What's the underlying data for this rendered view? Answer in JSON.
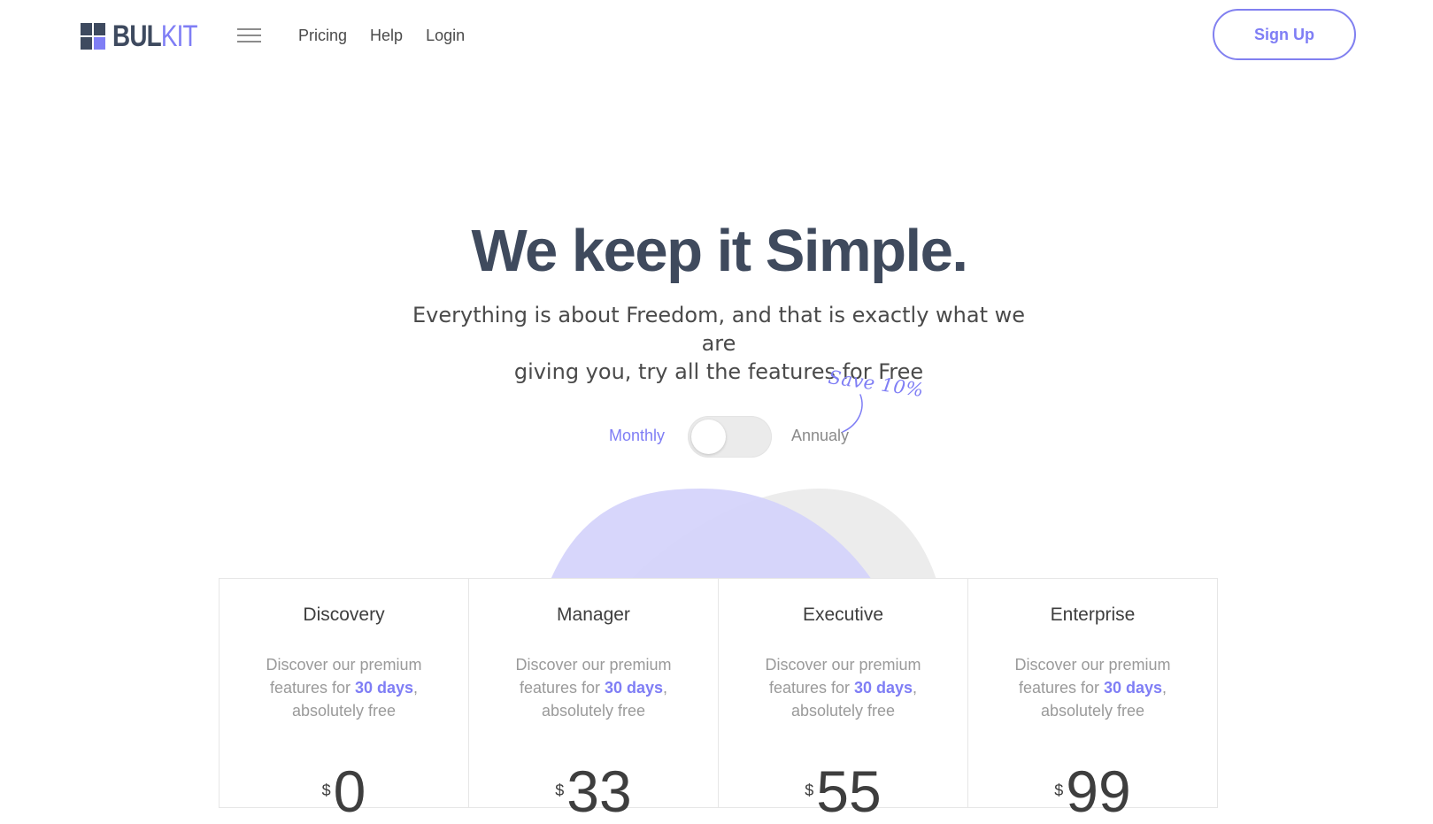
{
  "brand": {
    "logo_part1": "BUL",
    "logo_part2": "KIT"
  },
  "nav": {
    "links": [
      "Pricing",
      "Help",
      "Login"
    ],
    "signup_label": "Sign Up"
  },
  "hero": {
    "title": "We keep it Simple.",
    "subtitle_line1": "Everything is about Freedom, and that is exactly what we are",
    "subtitle_line2": "giving you, try all the features for Free"
  },
  "billing": {
    "monthly_label": "Monthly",
    "annual_label": "Annualy",
    "save_note": "Save 10%",
    "selected": "Monthly"
  },
  "plans": [
    {
      "name": "Discovery",
      "desc_a": "Discover our premium features for ",
      "desc_hl": "30 days",
      "desc_b": ", absolutely free",
      "currency": "$",
      "price": "0"
    },
    {
      "name": "Manager",
      "desc_a": "Discover our premium features for ",
      "desc_hl": "30 days",
      "desc_b": ", absolutely free",
      "currency": "$",
      "price": "33"
    },
    {
      "name": "Executive",
      "desc_a": "Discover our premium features for ",
      "desc_hl": "30 days",
      "desc_b": ", absolutely free",
      "currency": "$",
      "price": "55"
    },
    {
      "name": "Enterprise",
      "desc_a": "Discover our premium features for ",
      "desc_hl": "30 days",
      "desc_b": ", absolutely free",
      "currency": "$",
      "price": "99"
    }
  ],
  "colors": {
    "accent": "#7f7ef5",
    "heading": "#3f4a5d",
    "muted": "#9a9a9a",
    "blob_primary": "#d4d3fb",
    "blob_secondary": "#ececec"
  }
}
